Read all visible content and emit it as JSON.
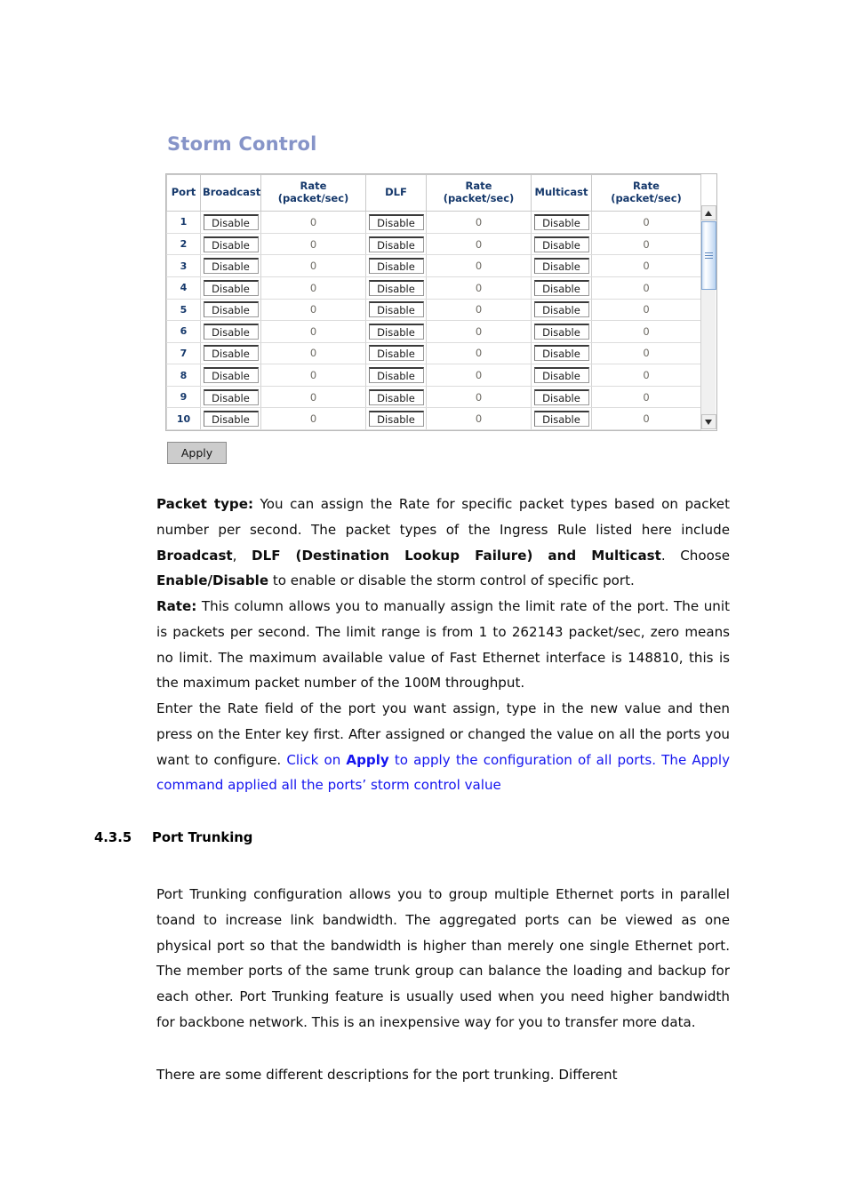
{
  "figure": {
    "panel_title": "Storm Control",
    "table": {
      "headers": [
        "Port",
        "Broadcast",
        "Rate\n(packet/sec)",
        "DLF",
        "Rate\n(packet/sec)",
        "Multicast",
        "Rate\n(packet/sec)"
      ],
      "header_lines": {
        "port": "Port",
        "broadcast": "Broadcast",
        "rate_line1": "Rate",
        "rate_line2": "(packet/sec)",
        "dlf": "DLF",
        "multicast": "Multicast"
      },
      "rows": [
        {
          "port": "1",
          "broadcast": "Disable",
          "broadcast_rate": "0",
          "dlf": "Disable",
          "dlf_rate": "0",
          "multicast": "Disable",
          "multicast_rate": "0"
        },
        {
          "port": "2",
          "broadcast": "Disable",
          "broadcast_rate": "0",
          "dlf": "Disable",
          "dlf_rate": "0",
          "multicast": "Disable",
          "multicast_rate": "0"
        },
        {
          "port": "3",
          "broadcast": "Disable",
          "broadcast_rate": "0",
          "dlf": "Disable",
          "dlf_rate": "0",
          "multicast": "Disable",
          "multicast_rate": "0"
        },
        {
          "port": "4",
          "broadcast": "Disable",
          "broadcast_rate": "0",
          "dlf": "Disable",
          "dlf_rate": "0",
          "multicast": "Disable",
          "multicast_rate": "0"
        },
        {
          "port": "5",
          "broadcast": "Disable",
          "broadcast_rate": "0",
          "dlf": "Disable",
          "dlf_rate": "0",
          "multicast": "Disable",
          "multicast_rate": "0"
        },
        {
          "port": "6",
          "broadcast": "Disable",
          "broadcast_rate": "0",
          "dlf": "Disable",
          "dlf_rate": "0",
          "multicast": "Disable",
          "multicast_rate": "0"
        },
        {
          "port": "7",
          "broadcast": "Disable",
          "broadcast_rate": "0",
          "dlf": "Disable",
          "dlf_rate": "0",
          "multicast": "Disable",
          "multicast_rate": "0"
        },
        {
          "port": "8",
          "broadcast": "Disable",
          "broadcast_rate": "0",
          "dlf": "Disable",
          "dlf_rate": "0",
          "multicast": "Disable",
          "multicast_rate": "0"
        },
        {
          "port": "9",
          "broadcast": "Disable",
          "broadcast_rate": "0",
          "dlf": "Disable",
          "dlf_rate": "0",
          "multicast": "Disable",
          "multicast_rate": "0"
        },
        {
          "port": "10",
          "broadcast": "Disable",
          "broadcast_rate": "0",
          "dlf": "Disable",
          "dlf_rate": "0",
          "multicast": "Disable",
          "multicast_rate": "0"
        }
      ]
    },
    "apply_label": "Apply",
    "scrollbar": {
      "up_arrow": "scroll-up-arrow",
      "down_arrow": "scroll-down-arrow"
    }
  },
  "document": {
    "paragraphs": {
      "packet_type": {
        "lead": "Packet type:",
        "text_1": " You can assign the Rate for specific packet types based on packet number per second. The packet types of the Ingress Rule listed here include ",
        "bold_1": "Broadcast",
        "text_2": ", ",
        "bold_2": "DLF (Destination Lookup Failure) and Multicast",
        "text_3": ". Choose ",
        "bold_3": "Enable/Disable",
        "text_4": " to enable or disable the storm control of specific port."
      },
      "rate": {
        "lead": "Rate:",
        "text": " This column allows you to manually assign the limit rate of the port. The unit is packets per second. The limit range is from 1 to 262143 packet/sec, zero means no limit. The maximum available value of Fast Ethernet interface is 148810, this is the maximum packet number of the 100M throughput."
      },
      "enter": {
        "text_black": "Enter the Rate field of the port you want assign, type in the new value and then press on the Enter key first. After assigned or changed the value on all the ports you want to configure. ",
        "blue_1": "Click on ",
        "blue_bold": "Apply",
        "blue_2": " to apply the configuration of all ports. The Apply command applied all the ports’ storm control value"
      },
      "trunking": "Port Trunking configuration allows you to group multiple Ethernet ports in parallel toand to increase link bandwidth. The aggregated ports can be viewed as one physical port so that the bandwidth is higher than merely one single Ethernet port. The member ports of the same trunk group can balance the loading and backup for each other. Port Trunking feature is usually used when you need higher bandwidth for backbone network. This is an inexpensive way for you to transfer more data.",
      "descriptions": "There are some different descriptions for the port trunking. Different"
    },
    "heading": {
      "number": "4.3.5",
      "title": "Port Trunking"
    }
  },
  "colors": {
    "panel_title": "#8694c8",
    "table_header_text": "#15386b",
    "port_number_text": "#15386b",
    "rate_value_text": "#6d6a63",
    "link_blue": "#1414ef",
    "apply_button_bg": "#cccccc",
    "scrollbar_thumb": "#b9d3f0"
  }
}
